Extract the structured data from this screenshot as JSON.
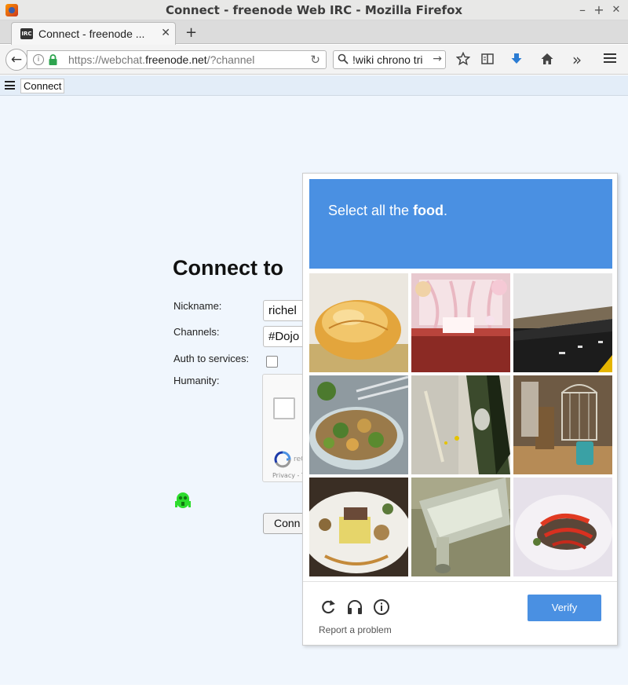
{
  "window": {
    "title": "Connect - freenode Web IRC - Mozilla Firefox",
    "minimize_glyph": "–",
    "maximize_glyph": "+",
    "close_glyph": "✕"
  },
  "tabs": {
    "active_label": "Connect - freenode ...",
    "favicon_text": "IRC",
    "close_glyph": "✕",
    "new_tab_glyph": "+"
  },
  "nav": {
    "back_glyph": "←",
    "url_prefix": "https://webchat.",
    "url_domain": "freenode.net",
    "url_suffix": "/?channel",
    "reload_glyph": "↻",
    "search_value": "!wiki chrono tri",
    "search_go_glyph": "→",
    "toolbar_icons": [
      "star-icon",
      "reading-list-icon",
      "download-icon",
      "home-icon",
      "overflow-icon",
      "hamburger-menu-icon"
    ],
    "overflow_glyph": "»",
    "accent_download": "#2b7cd3"
  },
  "irc": {
    "tab_label": "Connect",
    "heading": "Connect to",
    "nickname_label": "Nickname:",
    "nickname_value": "richel",
    "channels_label": "Channels:",
    "channels_value": "#Dojo",
    "auth_label": "Auth to services:",
    "humanity_label": "Humanity:",
    "recaptcha_small": "reC",
    "recaptcha_privacy": "Privacy - T",
    "connect_button": "Conn"
  },
  "captcha": {
    "prompt_prefix": "Select all the ",
    "prompt_target": "food",
    "prompt_suffix": ".",
    "header_color": "#4a90e2",
    "tiles": [
      {
        "subject": "bread roll"
      },
      {
        "subject": "decorated stage"
      },
      {
        "subject": "dark ledge"
      },
      {
        "subject": "salad bowl"
      },
      {
        "subject": "blurred bicycle"
      },
      {
        "subject": "birdcage and jars"
      },
      {
        "subject": "plated dish"
      },
      {
        "subject": "glass bottle"
      },
      {
        "subject": "fish with peppers"
      }
    ],
    "verify_label": "Verify",
    "report_label": "Report a problem",
    "footer_icons": [
      "reload-icon",
      "audio-icon",
      "info-icon"
    ]
  }
}
